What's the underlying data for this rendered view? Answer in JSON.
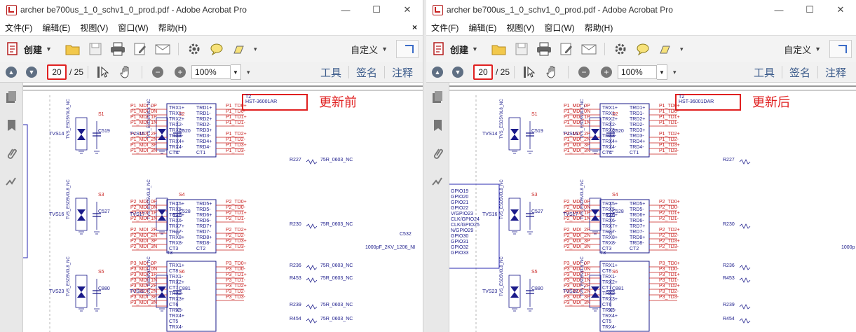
{
  "windows": [
    {
      "id": "left",
      "title": "archer be700us_1_0_schv1_0_prod.pdf - Adobe Acrobat Pro",
      "menus": [
        "文件(F)",
        "编辑(E)",
        "视图(V)",
        "窗口(W)",
        "帮助(H)"
      ],
      "menu_close": "×",
      "create_label": "创建",
      "customize_label": "自定义",
      "page_current": "20",
      "page_total": "/ 25",
      "zoom": "100%",
      "nav_right": [
        "工具",
        "签名",
        "注释"
      ],
      "annotation_label": "更新前",
      "part_ref": "T2",
      "part_number": "HST-36001AR",
      "t3_ref": "T3",
      "cap_label": "C532",
      "cap_value": "1000pF_2KV_1206_NI",
      "gpio_labels": []
    },
    {
      "id": "right",
      "title": "archer be700us_1_0_schv1_0_prod.pdf - Adobe Acrobat Pro",
      "menus": [
        "文件(F)",
        "编辑(E)",
        "视图(V)",
        "窗口(W)",
        "帮助(H)"
      ],
      "menu_close": "",
      "create_label": "创建",
      "customize_label": "自定义",
      "page_current": "20",
      "page_total": "/ 25",
      "zoom": "100%",
      "nav_right": [
        "工具",
        "签名",
        "注释"
      ],
      "annotation_label": "更新后",
      "part_ref": "T2",
      "part_number": "HST-36001DAR",
      "t3_ref": "T3",
      "cap_label": "",
      "cap_value": "1000p",
      "gpio_labels": [
        "GPIO19",
        "GPIO20",
        "GPIO21",
        "GPIO22",
        "V/GPIO23",
        "CLK/GPIO24",
        "CLK/GPIO25",
        "N/GPIO29",
        "GPIO30",
        "GPIO31",
        "GPIO32",
        "GPIO33"
      ]
    }
  ],
  "schematic": {
    "nets_top": [
      "P1_MDI_0P",
      "P1_MDI_0N",
      "P1_MDI_1P",
      "P1_MDI_1N",
      "P1_MDI_2P",
      "P1_MDI_2N",
      "P1_MDI_3P",
      "P1_MDI_3N"
    ],
    "pins_top": [
      "TRX1+",
      "TRX1-",
      "TRX2+",
      "TRX2-",
      "TRX3+",
      "TRX3-",
      "TRX4+",
      "TRX4-",
      "CT4"
    ],
    "pins_top_right": [
      "TRD1+",
      "TRD1-",
      "TRD2+",
      "TRD2-",
      "TRD3+",
      "TRD3-",
      "TRD4+",
      "TRD4-",
      "CT1"
    ],
    "td_top": [
      "P1_TD0+",
      "P1_TD0-",
      "P1_TD1+",
      "P1_TD1-",
      "P1_TD2+",
      "P1_TD2-",
      "P1_TD3+",
      "P1_TD3-"
    ],
    "nets_mid": [
      "P2_MDI_0P",
      "P2_MDI_0N",
      "P2_MDI_1P",
      "P2_MDI_1N",
      "P2_MDI_2P",
      "P2_MDI_2N",
      "P2_MDI_3P",
      "P2_MDI_3N"
    ],
    "pins_mid": [
      "TRX5+",
      "TRX5-",
      "TRX6+",
      "TRX6-",
      "TRX7+",
      "TRX7-",
      "TRX8+",
      "TRX8-",
      "CT3"
    ],
    "pins_mid_right": [
      "TRD5+",
      "TRD5-",
      "TRD6+",
      "TRD6-",
      "TRD7+",
      "TRD7-",
      "TRD8+",
      "TRD8-",
      "CT2"
    ],
    "td_mid": [
      "P2_TD0+",
      "P2_TD0-",
      "P2_TD1+",
      "P2_TD1-",
      "P2_TD2+",
      "P2_TD2-",
      "P2_TD3+",
      "P2_TD3-"
    ],
    "nets_bot": [
      "P3_MDI_0P",
      "P3_MDI_0N",
      "P3_MDI_1P",
      "P3_MDI_1N",
      "P3_MDI_2P",
      "P3_MDI_2N",
      "P3_MDI_3P",
      "P3_MDI_3N"
    ],
    "pins_bot": [
      "TRX1+",
      "CT8",
      "TRX1-",
      "TRX2+",
      "CT7",
      "TRX2-",
      "TRX3+",
      "CT6",
      "TRX3-",
      "TRX4+",
      "CT5",
      "TRX4-"
    ],
    "td_bot": [
      "P3_TD0+",
      "P3_TD0-",
      "P3_TD1+",
      "P3_TD1-",
      "P3_TD2+",
      "P3_TD2-",
      "P3_TD3-"
    ],
    "resistors": [
      "R227",
      "R230",
      "R236",
      "R453",
      "R239",
      "R454"
    ],
    "res_value": "75R_0603_NC",
    "tvs": [
      "TVS14",
      "TVS15",
      "TVS16",
      "TVS17",
      "TVS23",
      "TVS22"
    ],
    "caps": [
      "C519",
      "C520",
      "C527",
      "C528",
      "C880",
      "C881"
    ],
    "sheet_markers": [
      "S1",
      "S2",
      "S3",
      "S4",
      "S5",
      "S6"
    ],
    "tvs_part": "TVS_ESD5V0L8_NC"
  },
  "colors": {
    "annotation": "#e02020",
    "net_red": "#c8201f",
    "wire": "#1a1a8a",
    "toolbar_bg": "#f3f3f3"
  }
}
